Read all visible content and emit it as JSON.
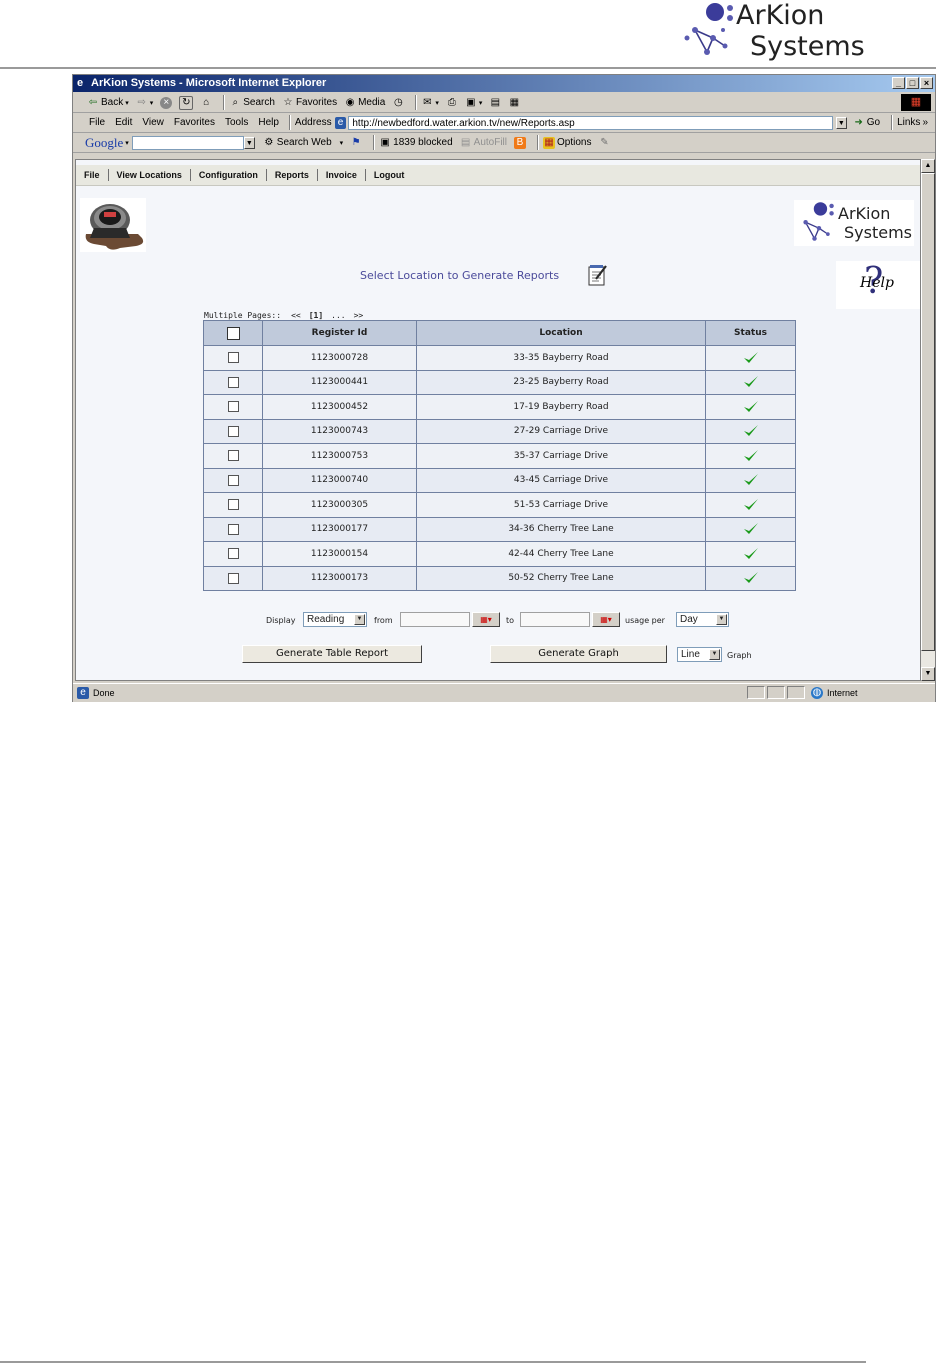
{
  "doc_header": {
    "logo_line1": "ArKion",
    "logo_line2": "Systems"
  },
  "window": {
    "title": "ArKion Systems - Microsoft Internet Explorer",
    "controls": {
      "minimize": "_",
      "maximize": "□",
      "close": "×"
    }
  },
  "toolbar": {
    "back": "Back",
    "search": "Search",
    "favorites": "Favorites",
    "media": "Media"
  },
  "menubar": [
    "File",
    "Edit",
    "View",
    "Favorites",
    "Tools",
    "Help"
  ],
  "address": {
    "label": "Address",
    "url": "http://newbedford.water.arkion.tv/new/Reports.asp",
    "go": "Go",
    "links": "Links"
  },
  "google_bar": {
    "logo": "Google",
    "search_web": "Search Web",
    "blocked": "1839 blocked",
    "autofill": "AutoFill",
    "options": "Options"
  },
  "app": {
    "nav": [
      "File",
      "View Locations",
      "Configuration",
      "Reports",
      "Invoice",
      "Logout"
    ],
    "logo_line1": "ArKion",
    "logo_line2": "Systems",
    "help_label": "Help",
    "heading": "Select Location to Generate Reports",
    "pager": {
      "label": "Multiple Pages::",
      "first": "<<",
      "current": "[1]",
      "ellipsis": "...",
      "last": ">>"
    },
    "table": {
      "headers": [
        "",
        "Register Id",
        "Location",
        "Status"
      ],
      "rows": [
        {
          "register_id": "1123000728",
          "location": "33-35 Bayberry Road"
        },
        {
          "register_id": "1123000441",
          "location": "23-25 Bayberry Road"
        },
        {
          "register_id": "1123000452",
          "location": "17-19 Bayberry Road"
        },
        {
          "register_id": "1123000743",
          "location": "27-29 Carriage Drive"
        },
        {
          "register_id": "1123000753",
          "location": "35-37 Carriage Drive"
        },
        {
          "register_id": "1123000740",
          "location": "43-45 Carriage Drive"
        },
        {
          "register_id": "1123000305",
          "location": "51-53 Carriage Drive"
        },
        {
          "register_id": "1123000177",
          "location": "34-36 Cherry Tree Lane"
        },
        {
          "register_id": "1123000154",
          "location": "42-44 Cherry Tree Lane"
        },
        {
          "register_id": "1123000173",
          "location": "50-52 Cherry Tree Lane"
        }
      ],
      "status_color": "#1a9a1a"
    },
    "controls": {
      "display_label": "Display",
      "display_value": "Reading",
      "from_label": "from",
      "to_label": "to",
      "usage_label": "usage per",
      "usage_value": "Day",
      "graph_type": "Line",
      "graph_label": "Graph",
      "table_button": "Generate Table Report",
      "graph_button": "Generate Graph"
    }
  },
  "statusbar": {
    "left": "Done",
    "zone": "Internet"
  }
}
